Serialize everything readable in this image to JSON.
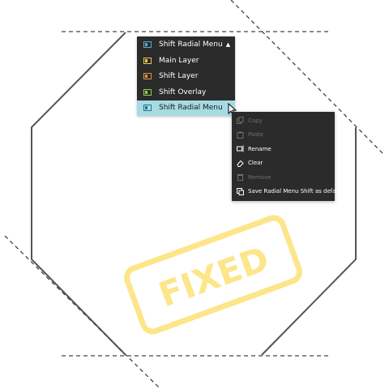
{
  "layer_dropdown": {
    "selected_label": "Shift Radial Menu",
    "items": [
      {
        "label": "Main Layer",
        "icon": "layer-main-icon",
        "color": "#e8c84a"
      },
      {
        "label": "Shift Layer",
        "icon": "layer-shift-icon",
        "color": "#e0913c"
      },
      {
        "label": "Shift Overlay",
        "icon": "layer-overlay-icon",
        "color": "#8fd14f"
      },
      {
        "label": "Shift Radial Menu",
        "icon": "layer-radial-icon",
        "color": "#5aa6d6",
        "selected": true
      }
    ]
  },
  "context_menu": {
    "items": [
      {
        "label": "Copy",
        "icon": "copy-icon",
        "enabled": false
      },
      {
        "label": "Paste",
        "icon": "paste-icon",
        "enabled": false
      },
      {
        "label": "Rename",
        "icon": "rename-icon",
        "enabled": true
      },
      {
        "label": "Clear",
        "icon": "eraser-icon",
        "enabled": true
      },
      {
        "label": "Remove",
        "icon": "trash-icon",
        "enabled": false
      },
      {
        "label": "Save Radial Menu Shift as default",
        "icon": "save-default-icon",
        "enabled": true
      }
    ]
  },
  "stamp": {
    "text": "FIXED",
    "color": "#fde68a"
  },
  "colors": {
    "menu_background": "#2b2b2b",
    "selected_highlight": "#a6dbe3",
    "disabled_text": "#6f6f6f",
    "outline": "#555555"
  }
}
